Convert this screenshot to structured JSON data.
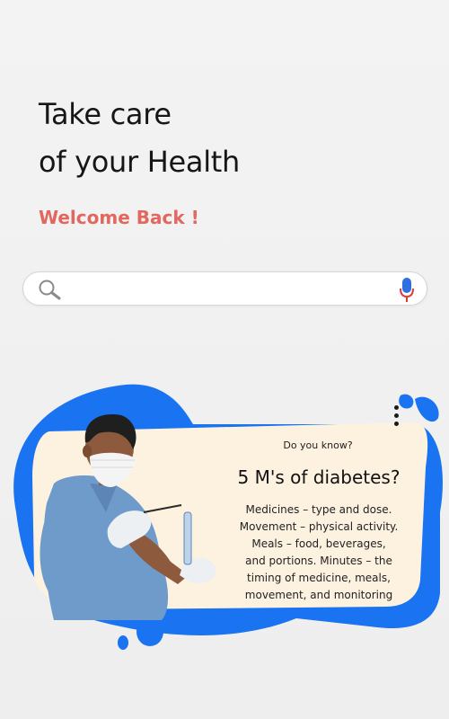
{
  "header": {
    "title_line_1": "Take care",
    "title_line_2": "of your Health",
    "welcome": "Welcome Back !"
  },
  "search": {
    "placeholder": "",
    "value": "",
    "left_icon": "search-icon",
    "right_icon": "microphone-icon"
  },
  "tip_card": {
    "kicker": "Do you know?",
    "heading": "5 M's of diabetes?",
    "lines": [
      "Medicines – type and dose.",
      "Movement – physical activity.",
      "Meals – food, beverages,",
      "and portions. Minutes – the",
      "timing of medicine, meals,",
      "movement, and monitoring"
    ],
    "menu_icon": "more-vertical-icon",
    "illustration": "doctor-with-test-tube-illustration"
  },
  "colors": {
    "accent_red": "#e2675f",
    "blob_blue": "#1a73f0",
    "card_cream": "#fdf1e0",
    "background": "#f1f1f1"
  }
}
